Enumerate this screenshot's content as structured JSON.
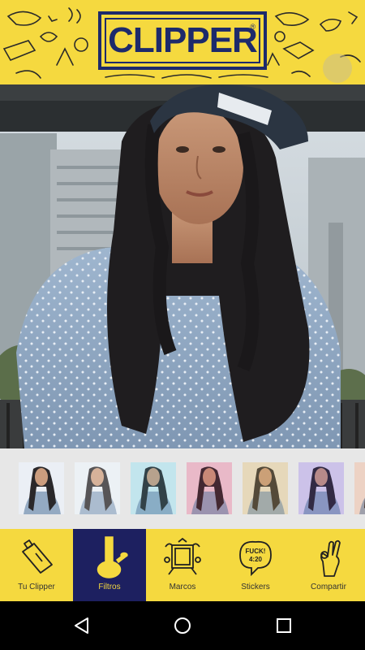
{
  "header": {
    "logo_text": "CLIPPER",
    "logo_mark": "®"
  },
  "filters": {
    "items": [
      {
        "tint": "#eaeff5",
        "overlay": "rgba(255,255,255,0.05)"
      },
      {
        "tint": "#e6ecf2",
        "overlay": "rgba(255,255,255,0.25)"
      },
      {
        "tint": "#d8edf3",
        "overlay": "rgba(120,200,220,0.22)"
      },
      {
        "tint": "#f2d7df",
        "overlay": "rgba(200,80,120,0.22)"
      },
      {
        "tint": "#efe9d7",
        "overlay": "rgba(210,180,120,0.30)"
      },
      {
        "tint": "#e4dff2",
        "overlay": "rgba(120,90,200,0.22)"
      },
      {
        "tint": "#f2e6df",
        "overlay": "rgba(220,140,100,0.22)"
      }
    ]
  },
  "toolbar": {
    "items": [
      {
        "label": "Tu Clipper",
        "icon": "lighter-icon",
        "active": false
      },
      {
        "label": "Filtros",
        "icon": "bong-icon",
        "active": true
      },
      {
        "label": "Marcos",
        "icon": "frame-icon",
        "active": false
      },
      {
        "label": "Stickers",
        "icon": "sticker-icon",
        "active": false
      },
      {
        "label": "Compartir",
        "icon": "hand-icon",
        "active": false
      }
    ]
  },
  "sticker_text": "FUCK! 4:20",
  "colors": {
    "brand_yellow": "#f5d93f",
    "brand_navy": "#1d2060",
    "navbar": "#000000"
  }
}
